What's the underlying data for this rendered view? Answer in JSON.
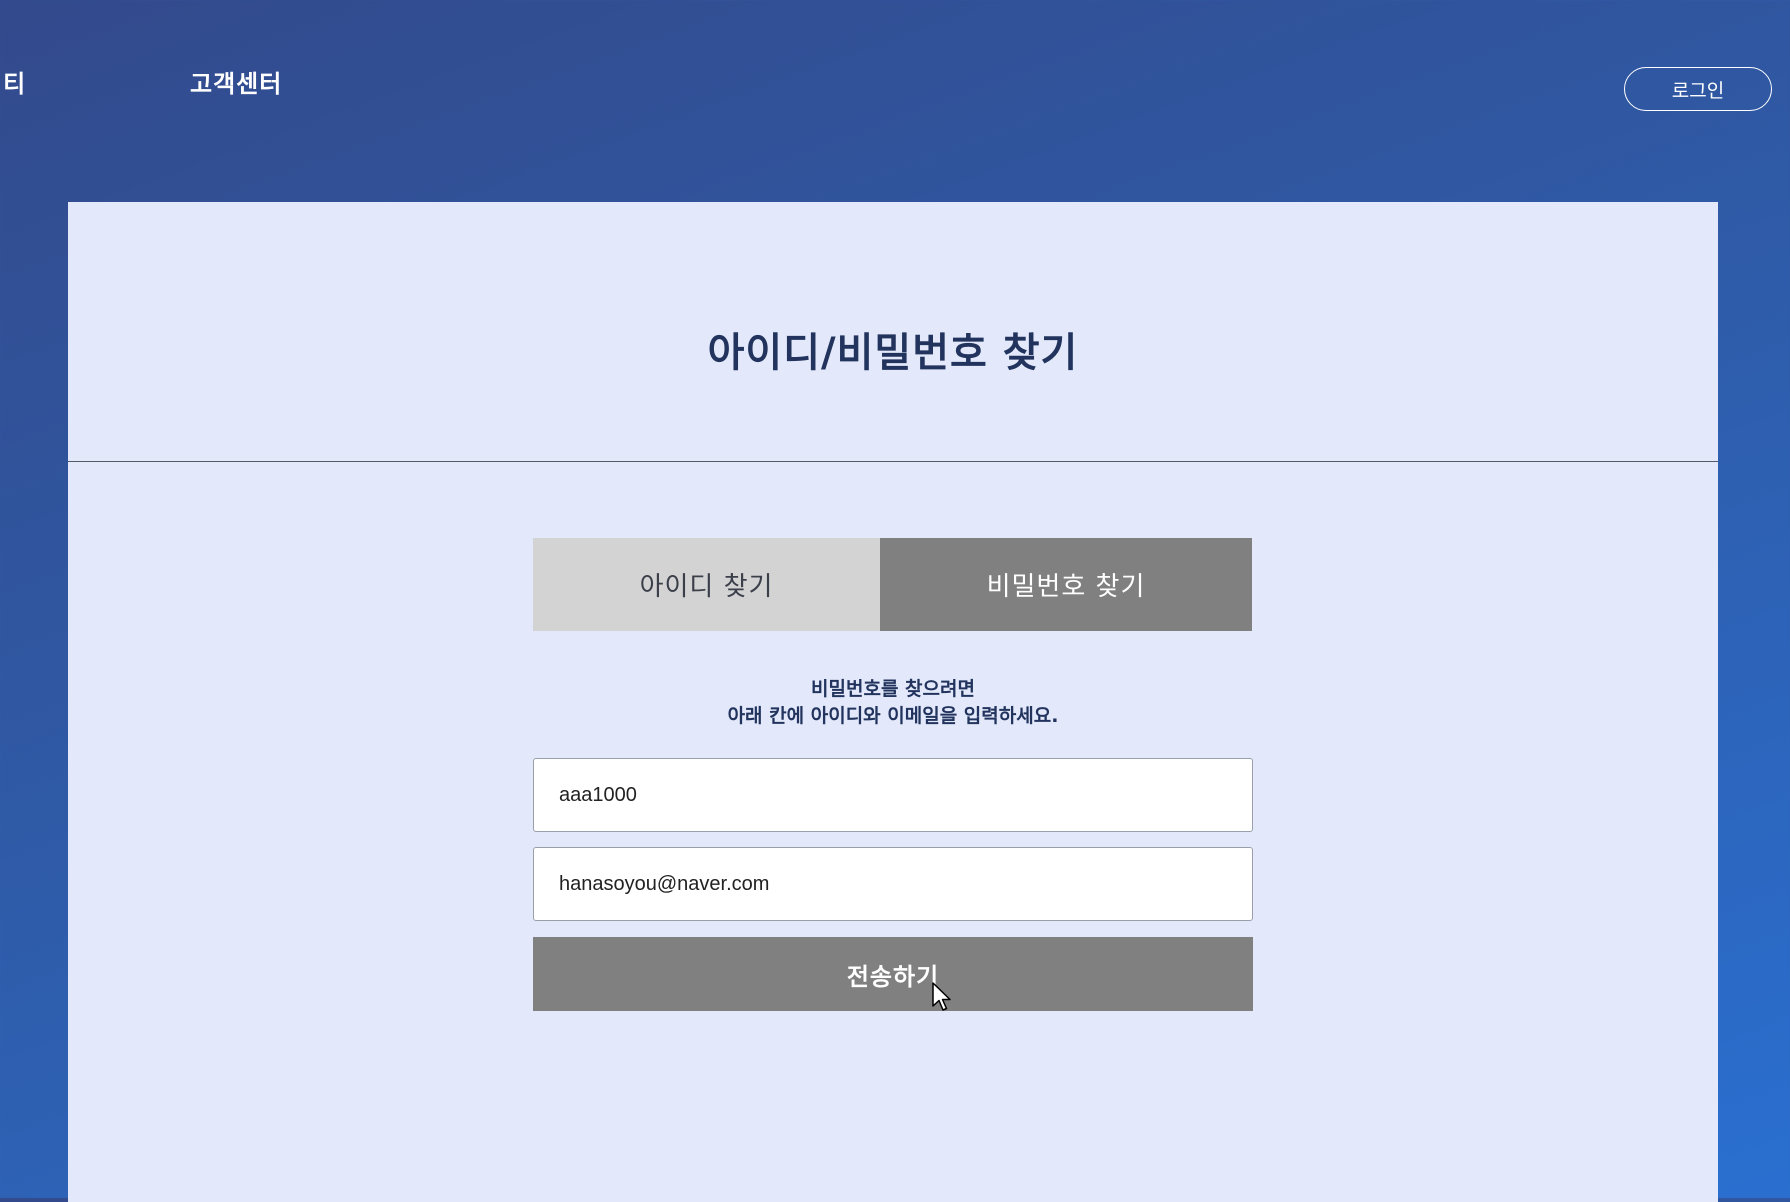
{
  "nav": {
    "community_label": "니티",
    "support_label": "고객센터",
    "login_label": "로그인"
  },
  "page": {
    "title": "아이디/비밀번호 찾기"
  },
  "tabs": [
    {
      "label": "아이디 찾기",
      "active": false
    },
    {
      "label": "비밀번호 찾기",
      "active": true
    }
  ],
  "instructions": {
    "line1": "비밀번호를 찾으려면",
    "line2": "아래 칸에 아이디와 이메일을 입력하세요."
  },
  "form": {
    "id_value": "aaa1000",
    "email_value": "hanasoyou@naver.com",
    "submit_label": "전송하기"
  },
  "colors": {
    "panel_bg": "#e3e9fa",
    "title_text": "#22345e",
    "active_tab": "#808080",
    "inactive_tab": "#d3d3d3",
    "submit_bg": "#808080"
  },
  "icons": {
    "cursor": "mouse-pointer-icon"
  }
}
